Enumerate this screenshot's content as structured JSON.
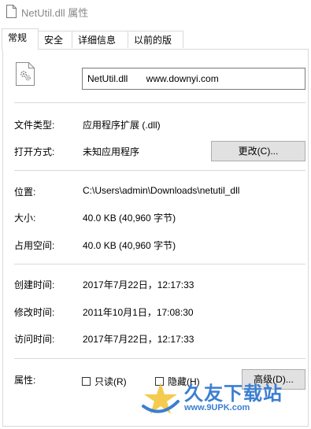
{
  "window": {
    "title": "NetUtil.dll 属性"
  },
  "tabs": [
    {
      "label": "常规"
    },
    {
      "label": "安全"
    },
    {
      "label": "详细信息"
    },
    {
      "label": "以前的版本"
    }
  ],
  "general": {
    "filename": "NetUtil.dll       www.downyi.com",
    "file_type_label": "文件类型:",
    "file_type_value": "应用程序扩展 (.dll)",
    "opens_with_label": "打开方式:",
    "opens_with_value": "未知应用程序",
    "change_button": "更改(C)...",
    "location_label": "位置:",
    "location_value": "C:\\Users\\admin\\Downloads\\netutil_dll",
    "size_label": "大小:",
    "size_value": "40.0 KB (40,960 字节)",
    "size_on_disk_label": "占用空间:",
    "size_on_disk_value": "40.0 KB (40,960 字节)",
    "created_label": "创建时间:",
    "created_value": "2017年7月22日，12:17:33",
    "modified_label": "修改时间:",
    "modified_value": "2011年10月1日，17:08:30",
    "accessed_label": "访问时间:",
    "accessed_value": "2017年7月22日，12:17:33",
    "attributes_label": "属性:",
    "readonly_label": "只读(R)",
    "hidden_label": "隐藏(H)",
    "advanced_button": "高级(D)..."
  },
  "watermark": {
    "text": "久友下载站",
    "sub": "www.9UPK.com"
  },
  "colors": {
    "accent": "#3b7fd0",
    "border": "#d9d9d9",
    "button_bg": "#e1e1e1"
  }
}
